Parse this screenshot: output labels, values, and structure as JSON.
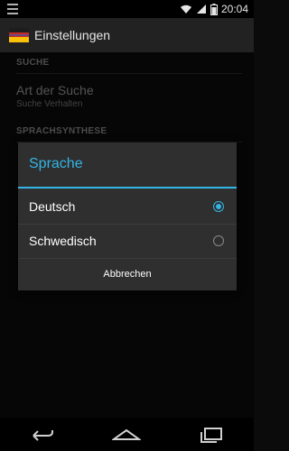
{
  "status_bar": {
    "time": "20:04",
    "icons": [
      "menu-icon",
      "wifi-icon",
      "signal-icon",
      "battery-icon"
    ]
  },
  "action_bar": {
    "title": "Einstellungen",
    "icon": "flag-icon"
  },
  "sections": {
    "suche": {
      "header": "SUCHE",
      "item": {
        "title": "Art der Suche",
        "summary": "Suche Verhalten"
      }
    },
    "sprachsynthese": {
      "header": "SPRACHSYNTHESE"
    }
  },
  "dialog": {
    "title": "Sprache",
    "options": [
      {
        "label": "Deutsch",
        "selected": true
      },
      {
        "label": "Schwedisch",
        "selected": false
      }
    ],
    "cancel_label": "Abbrechen"
  },
  "navigation_bar": {
    "buttons": [
      "back-icon",
      "home-icon",
      "recents-icon"
    ]
  },
  "colors": {
    "accent": "#33b5e5",
    "background": "#0b0b0b",
    "dialog": "#2f2f2f"
  }
}
